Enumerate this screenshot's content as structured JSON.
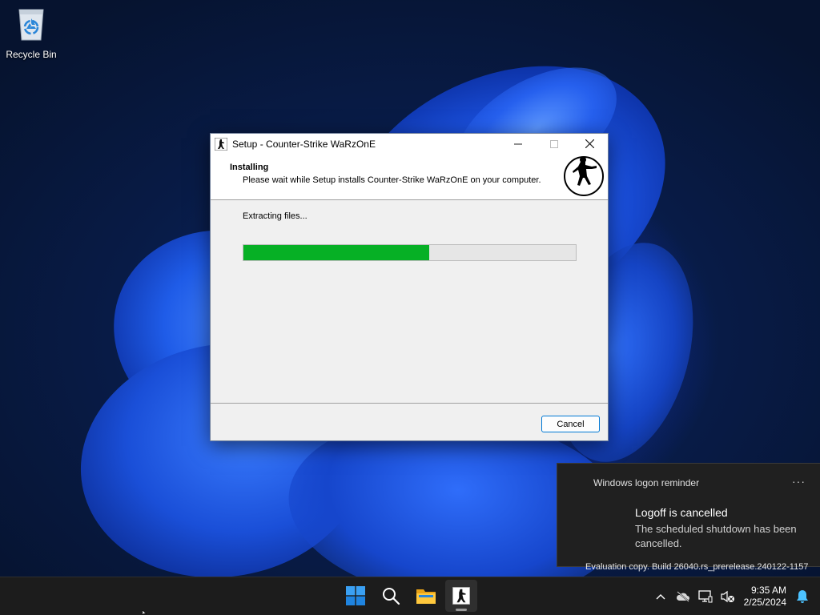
{
  "desktop": {
    "recycle_bin_label": "Recycle Bin"
  },
  "setup_window": {
    "title": "Setup - Counter-Strike WaRzOnE",
    "header_title": "Installing",
    "header_subtitle": "Please wait while Setup installs Counter-Strike WaRzOnE on your computer.",
    "status_text": "Extracting files...",
    "progress_fraction": 0.56,
    "cancel_label": "Cancel",
    "progress_color": "#06b025"
  },
  "notification": {
    "app_name": "Windows logon reminder",
    "more_label": "···",
    "title": "Logoff is cancelled",
    "body": "The scheduled shutdown has been cancelled."
  },
  "watermark": "Evaluation copy. Build 26040.rs_prerelease.240122-1157",
  "taskbar": {
    "items": [
      {
        "name": "start-button",
        "icon": "windows-logo-icon"
      },
      {
        "name": "search-button",
        "icon": "search-icon"
      },
      {
        "name": "file-explorer-button",
        "icon": "folder-icon"
      },
      {
        "name": "counter-strike-setup-button",
        "icon": "counter-strike-icon",
        "active": true
      }
    ],
    "tray": {
      "time": "9:35 AM",
      "date": "2/25/2024"
    }
  }
}
